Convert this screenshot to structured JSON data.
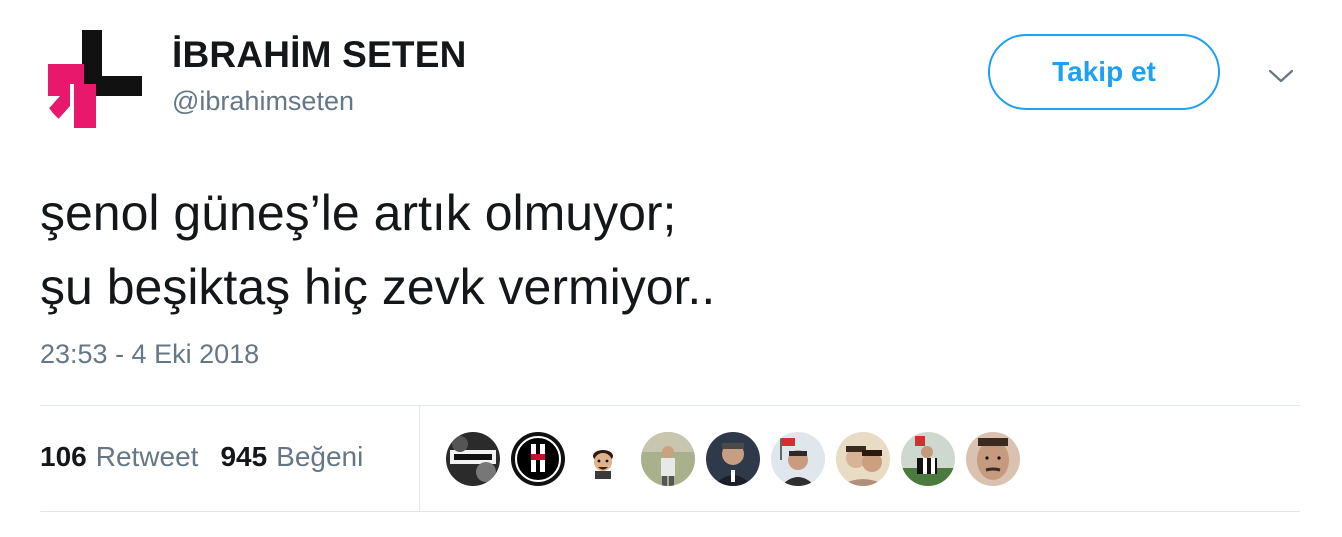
{
  "author": {
    "display_name": "İBRAHİM SETEN",
    "screen_name": "@ibrahimseten",
    "avatar_icon": "heforshe-logo-icon"
  },
  "follow_button": {
    "label": "Takip et",
    "color": "#1da1f2"
  },
  "menu": {
    "icon": "chevron-down-icon"
  },
  "tweet": {
    "lines": [
      "şenol güneş’le artık olmuyor;",
      "şu beşiktaş hiç zevk vermiyor.."
    ],
    "timestamp": "23:53 - 4 Eki 2018"
  },
  "stats": {
    "retweets": {
      "count": "106",
      "label": "Retweet"
    },
    "likes": {
      "count": "945",
      "label": "Beğeni"
    }
  },
  "likers": [
    {
      "icon": "user-avatar-icon"
    },
    {
      "icon": "besiktas-crest-icon"
    },
    {
      "icon": "cartoon-avatar-icon"
    },
    {
      "icon": "user-avatar-icon"
    },
    {
      "icon": "user-avatar-icon"
    },
    {
      "icon": "user-avatar-icon"
    },
    {
      "icon": "user-avatar-icon"
    },
    {
      "icon": "user-avatar-icon"
    },
    {
      "icon": "user-avatar-icon"
    }
  ],
  "colors": {
    "accent": "#1da1f2",
    "secondary_text": "#657786",
    "primary_text": "#14171a",
    "divider": "#e1e8ed",
    "logo_pink": "#e8196d",
    "logo_black": "#111111"
  }
}
